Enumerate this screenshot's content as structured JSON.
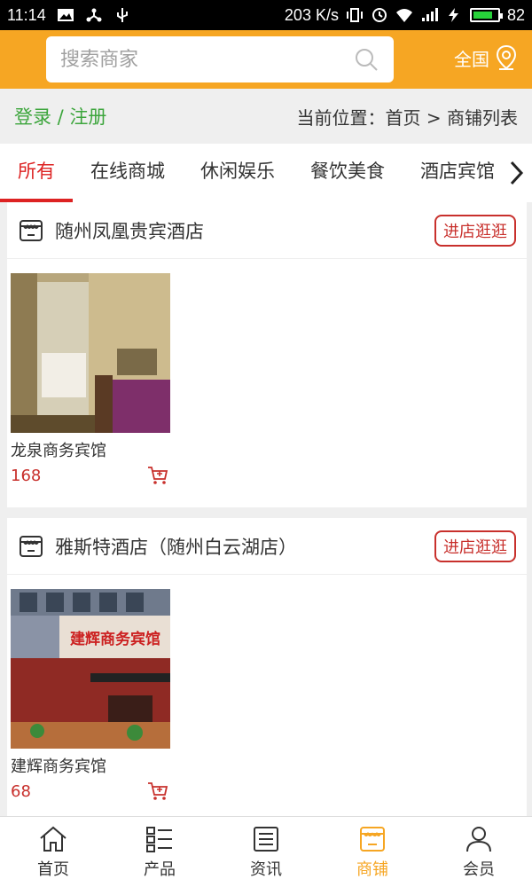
{
  "statusbar": {
    "time": "11:14",
    "speed": "203 K/s",
    "battery": "82",
    "battery_level": 0.82
  },
  "header": {
    "search_placeholder": "搜索商家",
    "region_label": "全国"
  },
  "crumbs": {
    "login_label": "登录 / 注册",
    "location": "当前位置：首页 > 商铺列表"
  },
  "tabs": [
    {
      "label": "所有",
      "active": true
    },
    {
      "label": "在线商城"
    },
    {
      "label": "休闲娱乐"
    },
    {
      "label": "餐饮美食"
    },
    {
      "label": "酒店宾馆"
    }
  ],
  "shops": [
    {
      "name": "随州凤凰贵宾酒店",
      "enter_label": "进店逛逛",
      "product": {
        "name": "龙泉商务宾馆",
        "price": "168"
      }
    },
    {
      "name": "雅斯特酒店（随州白云湖店）",
      "enter_label": "进店逛逛",
      "product": {
        "name": "建辉商务宾馆",
        "price": "68",
        "sign_text": "建辉商务宾馆"
      }
    }
  ],
  "nav": [
    {
      "label": "首页",
      "icon": "home-icon"
    },
    {
      "label": "产品",
      "icon": "list-icon"
    },
    {
      "label": "资讯",
      "icon": "news-icon"
    },
    {
      "label": "商铺",
      "icon": "store-icon",
      "active": true
    },
    {
      "label": "会员",
      "icon": "user-icon"
    }
  ],
  "colors": {
    "accent": "#f6a623",
    "red": "#c8302c",
    "green": "#3ca53c"
  }
}
